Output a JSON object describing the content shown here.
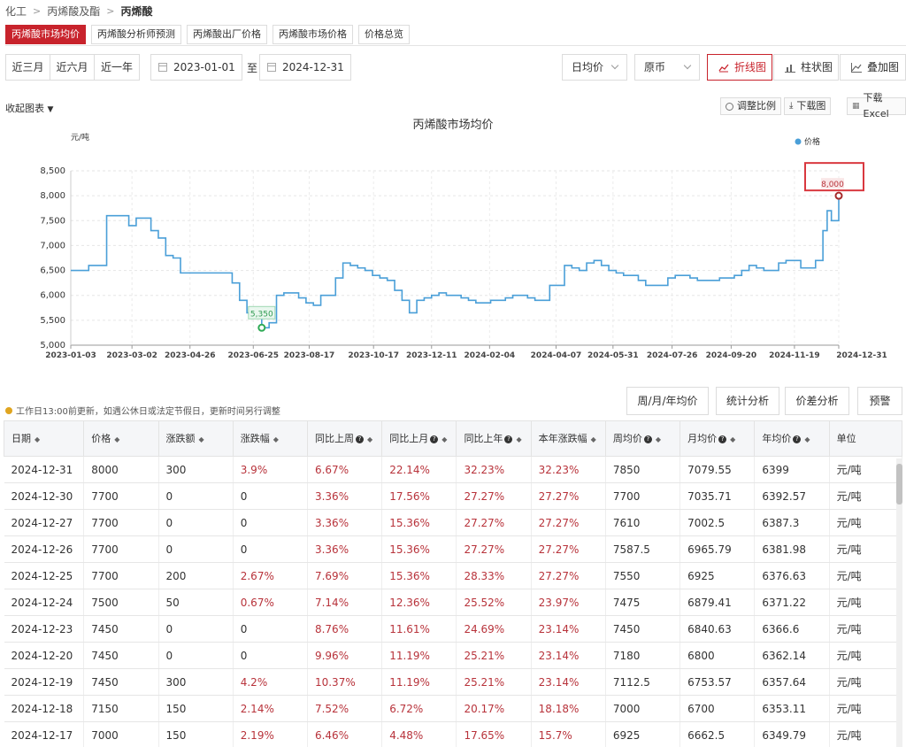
{
  "breadcrumb": [
    "化工",
    "丙烯酸及酯",
    "丙烯酸"
  ],
  "tabs": [
    "丙烯酸市场均价",
    "丙烯酸分析师预测",
    "丙烯酸出厂价格",
    "丙烯酸市场价格",
    "价格总览"
  ],
  "ranges": [
    "近三月",
    "近六月",
    "近一年"
  ],
  "date_start": "2023-01-01",
  "date_end": "2024-12-31",
  "to_label": "至",
  "select_period": "日均价",
  "select_currency": "原币",
  "views": [
    "折线图",
    "柱状图",
    "叠加图"
  ],
  "collapse_label": "收起图表",
  "tools": [
    "调整比例",
    "下载图",
    "下载Excel"
  ],
  "notice": "工作日13:00前更新，如遇公休日或法定节假日，更新时间另行调整",
  "actions": [
    "周/月/年均价",
    "统计分析",
    "价差分析",
    "预警"
  ],
  "colors": {
    "accent": "#c8232c",
    "line": "#4a9fd8",
    "up": "#b8333b",
    "min_marker": "#2eaa55"
  },
  "chart_data": {
    "type": "line",
    "title": "丙烯酸市场均价",
    "ylabel": "元/吨",
    "ylim": [
      5000,
      8500
    ],
    "yticks": [
      "5,000",
      "5,500",
      "6,000",
      "6,500",
      "7,000",
      "7,500",
      "8,000",
      "8,500"
    ],
    "xticks": [
      "2023-01-03",
      "2023-03-02",
      "2023-04-26",
      "2023-06-25",
      "2023-08-17",
      "2023-10-17",
      "2023-12-11",
      "2024-02-04",
      "2024-04-07",
      "2024-05-31",
      "2024-07-26",
      "2024-09-20",
      "2024-11-19",
      "2024-12-31"
    ],
    "legend": "价格",
    "grid": true,
    "annotations": {
      "min": "5,350",
      "max": "8,000"
    },
    "series": [
      {
        "x": [
          "2023-01-03",
          "2023-01-12",
          "2023-01-20",
          "2023-01-30",
          "2023-02-06",
          "2023-02-13",
          "2023-02-20",
          "2023-02-27",
          "2023-03-06",
          "2023-03-13",
          "2023-03-20",
          "2023-03-27",
          "2023-04-03",
          "2023-04-10",
          "2023-04-17",
          "2023-04-24",
          "2023-05-01",
          "2023-05-08",
          "2023-05-15",
          "2023-05-22",
          "2023-05-29",
          "2023-06-05",
          "2023-06-12",
          "2023-06-19",
          "2023-06-26",
          "2023-07-03",
          "2023-07-10",
          "2023-07-17",
          "2023-07-24",
          "2023-07-31",
          "2023-08-07",
          "2023-08-14",
          "2023-08-21",
          "2023-08-28",
          "2023-09-04",
          "2023-09-11",
          "2023-09-18",
          "2023-09-25",
          "2023-10-02",
          "2023-10-09",
          "2023-10-16",
          "2023-10-23",
          "2023-10-30",
          "2023-11-06",
          "2023-11-13",
          "2023-11-20",
          "2023-11-27",
          "2023-12-04",
          "2023-12-11",
          "2023-12-18",
          "2023-12-25",
          "2024-01-01",
          "2024-01-08",
          "2024-01-15",
          "2024-01-22",
          "2024-01-29",
          "2024-02-05",
          "2024-02-19",
          "2024-02-26",
          "2024-03-04",
          "2024-03-11",
          "2024-03-18",
          "2024-03-25",
          "2024-04-01",
          "2024-04-08",
          "2024-04-15",
          "2024-04-22",
          "2024-04-29",
          "2024-05-06",
          "2024-05-13",
          "2024-05-20",
          "2024-05-27",
          "2024-06-03",
          "2024-06-10",
          "2024-06-17",
          "2024-06-24",
          "2024-07-01",
          "2024-07-08",
          "2024-07-15",
          "2024-07-22",
          "2024-07-29",
          "2024-08-05",
          "2024-08-12",
          "2024-08-19",
          "2024-08-26",
          "2024-09-02",
          "2024-09-09",
          "2024-09-16",
          "2024-09-23",
          "2024-09-30",
          "2024-10-07",
          "2024-10-14",
          "2024-10-21",
          "2024-10-28",
          "2024-11-04",
          "2024-11-11",
          "2024-11-18",
          "2024-11-25",
          "2024-12-02",
          "2024-12-09",
          "2024-12-16",
          "2024-12-20",
          "2024-12-24",
          "2024-12-31"
        ],
        "y": [
          6500,
          6500,
          6600,
          6600,
          7600,
          7600,
          7600,
          7400,
          7550,
          7550,
          7300,
          7150,
          6800,
          6750,
          6450,
          6450,
          6450,
          6450,
          6450,
          6450,
          6450,
          6250,
          5900,
          5650,
          5550,
          5350,
          5450,
          6000,
          6050,
          6050,
          5950,
          5850,
          5800,
          6000,
          6000,
          6350,
          6650,
          6600,
          6550,
          6500,
          6400,
          6350,
          6300,
          6100,
          5900,
          5650,
          5900,
          5950,
          6000,
          6050,
          6000,
          6000,
          5950,
          5900,
          5850,
          5850,
          5900,
          5950,
          6000,
          6000,
          5950,
          5900,
          5900,
          6200,
          6200,
          6600,
          6550,
          6500,
          6650,
          6700,
          6600,
          6500,
          6450,
          6400,
          6400,
          6300,
          6200,
          6200,
          6200,
          6350,
          6400,
          6400,
          6350,
          6300,
          6300,
          6300,
          6350,
          6350,
          6400,
          6500,
          6600,
          6550,
          6500,
          6500,
          6650,
          6700,
          6700,
          6550,
          6550,
          6700,
          7300,
          7700,
          7500,
          8000
        ]
      }
    ]
  },
  "table": {
    "headers": [
      "日期",
      "价格",
      "涨跌额",
      "涨跌幅",
      "同比上周",
      "同比上月",
      "同比上年",
      "本年涨跌幅",
      "周均价",
      "月均价",
      "年均价",
      "单位"
    ],
    "rows": [
      [
        "2024-12-31",
        "8000",
        "300",
        "3.9%",
        "6.67%",
        "22.14%",
        "32.23%",
        "32.23%",
        "7850",
        "7079.55",
        "6399",
        "元/吨"
      ],
      [
        "2024-12-30",
        "7700",
        "0",
        "0",
        "3.36%",
        "17.56%",
        "27.27%",
        "27.27%",
        "7700",
        "7035.71",
        "6392.57",
        "元/吨"
      ],
      [
        "2024-12-27",
        "7700",
        "0",
        "0",
        "3.36%",
        "15.36%",
        "27.27%",
        "27.27%",
        "7610",
        "7002.5",
        "6387.3",
        "元/吨"
      ],
      [
        "2024-12-26",
        "7700",
        "0",
        "0",
        "3.36%",
        "15.36%",
        "27.27%",
        "27.27%",
        "7587.5",
        "6965.79",
        "6381.98",
        "元/吨"
      ],
      [
        "2024-12-25",
        "7700",
        "200",
        "2.67%",
        "7.69%",
        "15.36%",
        "28.33%",
        "27.27%",
        "7550",
        "6925",
        "6376.63",
        "元/吨"
      ],
      [
        "2024-12-24",
        "7500",
        "50",
        "0.67%",
        "7.14%",
        "12.36%",
        "25.52%",
        "23.97%",
        "7475",
        "6879.41",
        "6371.22",
        "元/吨"
      ],
      [
        "2024-12-23",
        "7450",
        "0",
        "0",
        "8.76%",
        "11.61%",
        "24.69%",
        "23.14%",
        "7450",
        "6840.63",
        "6366.6",
        "元/吨"
      ],
      [
        "2024-12-20",
        "7450",
        "0",
        "0",
        "9.96%",
        "11.19%",
        "25.21%",
        "23.14%",
        "7180",
        "6800",
        "6362.14",
        "元/吨"
      ],
      [
        "2024-12-19",
        "7450",
        "300",
        "4.2%",
        "10.37%",
        "11.19%",
        "25.21%",
        "23.14%",
        "7112.5",
        "6753.57",
        "6357.64",
        "元/吨"
      ],
      [
        "2024-12-18",
        "7150",
        "150",
        "2.14%",
        "7.52%",
        "6.72%",
        "20.17%",
        "18.18%",
        "7000",
        "6700",
        "6353.11",
        "元/吨"
      ],
      [
        "2024-12-17",
        "7000",
        "150",
        "2.19%",
        "6.46%",
        "4.48%",
        "17.65%",
        "15.7%",
        "6925",
        "6662.5",
        "6349.79",
        "元/吨"
      ]
    ]
  }
}
